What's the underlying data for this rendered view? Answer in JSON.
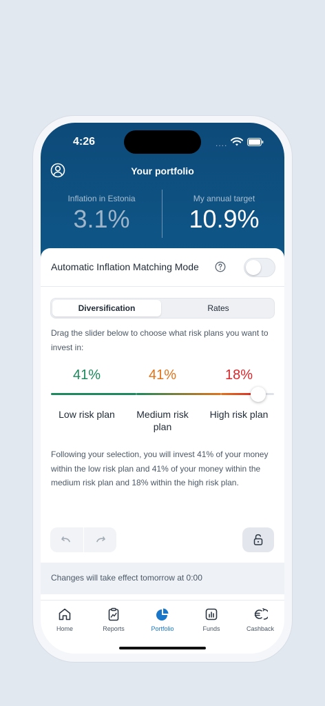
{
  "status_bar": {
    "time": "4:26",
    "signal_dots": "...."
  },
  "header": {
    "title": "Your portfolio",
    "inflation": {
      "label": "Inflation in Estonia",
      "value": "3.1%"
    },
    "target": {
      "label": "My annual target",
      "value": "10.9%"
    }
  },
  "mode": {
    "label": "Automatic Inflation Matching Mode",
    "enabled": false
  },
  "tabs": [
    {
      "label": "Diversification",
      "active": true
    },
    {
      "label": "Rates",
      "active": false
    }
  ],
  "instruction": "Drag the slider below to choose what risk plans you want to invest in:",
  "allocation": {
    "low": {
      "percent": 41,
      "text": "41%",
      "label": "Low risk plan"
    },
    "medium": {
      "percent": 41,
      "text": "41%",
      "label": "Medium risk plan"
    },
    "high": {
      "percent": 18,
      "text": "18%",
      "label": "High risk plan"
    }
  },
  "colors": {
    "low": "#1c8a5c",
    "medium": "#e1731b",
    "high": "#d8262a",
    "accent": "#1a76c8",
    "header": "#0d4a79"
  },
  "summary": "Following your selection, you will invest 41% of your money within the low risk plan and 41% of your money within the medium risk plan and 18% within the high risk plan.",
  "notice": "Changes will take effect tomorrow at 0:00",
  "nav": [
    {
      "label": "Home",
      "icon": "home-icon",
      "active": false
    },
    {
      "label": "Reports",
      "icon": "reports-icon",
      "active": false
    },
    {
      "label": "Portfolio",
      "icon": "portfolio-icon",
      "active": true
    },
    {
      "label": "Funds",
      "icon": "funds-icon",
      "active": false
    },
    {
      "label": "Cashback",
      "icon": "cashback-icon",
      "active": false
    }
  ]
}
